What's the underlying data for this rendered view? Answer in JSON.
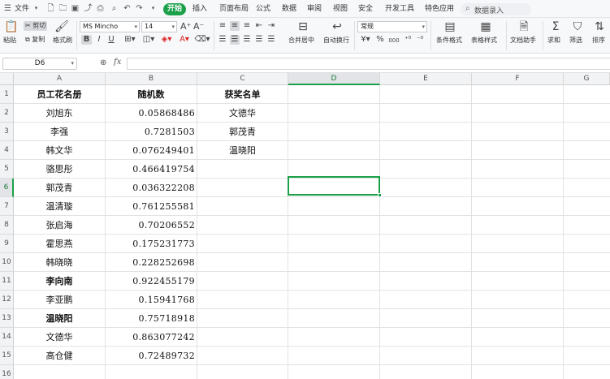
{
  "menu": {
    "file": "文件",
    "active_tab": "开始",
    "tabs": [
      "插入",
      "页面布局",
      "公式",
      "数据",
      "审阅",
      "视图",
      "安全",
      "开发工具",
      "特色应用"
    ],
    "search_placeholder": "数据录入"
  },
  "ribbon": {
    "paste": "粘贴",
    "cut": "剪切",
    "copy": "复制",
    "format_painter": "格式刷",
    "font_name": "MS Mincho",
    "font_size": "14",
    "bold": "B",
    "italic": "I",
    "underline": "U",
    "merge_center": "合并居中",
    "auto_wrap": "自动换行",
    "number_format": "常规",
    "percent": "%",
    "thousands": "000",
    "conditional_format": "条件格式",
    "table_style": "表格样式",
    "doc_helper": "文档助手",
    "sum": "求和",
    "filter": "筛选",
    "sort": "排序"
  },
  "formula_bar": {
    "cell_ref": "D6",
    "fx": "fx",
    "value": ""
  },
  "sheet": {
    "columns": [
      "A",
      "B",
      "C",
      "D",
      "E",
      "F",
      "G"
    ],
    "rows": [
      "1",
      "2",
      "3",
      "4",
      "5",
      "6",
      "7",
      "8",
      "9",
      "10",
      "11",
      "12",
      "13",
      "14",
      "15",
      "16"
    ],
    "col_a": [
      "员工花名册",
      "刘旭东",
      "李强",
      "韩文华",
      "骆思彤",
      "郭茂青",
      "温清璇",
      "张启海",
      "霍思燕",
      "韩晓晓",
      "李向南",
      "李亚鹏",
      "温晓阳",
      "文德华",
      "高仓健"
    ],
    "col_b": [
      "随机数",
      "0.05868486",
      "0.7281503",
      "0.076249401",
      "0.466419754",
      "0.036322208",
      "0.761255581",
      "0.70206552",
      "0.175231773",
      "0.228252698",
      "0.922455179",
      "0.15941768",
      "0.75718918",
      "0.863077242",
      "0.72489732"
    ],
    "col_c": [
      "获奖名单",
      "文德华",
      "郭茂青",
      "温晓阳"
    ],
    "selected_column": "D",
    "selected_row": "6"
  },
  "colors": {
    "accent": "#1ca14a",
    "header_bg": "#f2f3f5",
    "grid_line": "#e2e2e2"
  }
}
